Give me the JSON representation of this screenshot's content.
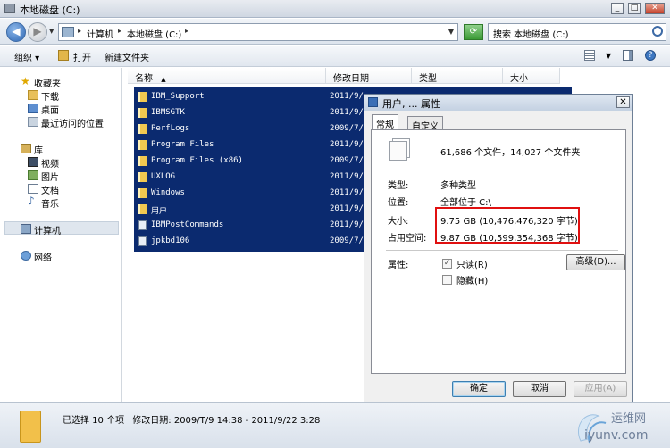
{
  "window": {
    "title": "本地磁盘 (C:)",
    "buttons": {
      "minimize": "_",
      "maximize": "□",
      "close": "✕"
    }
  },
  "address": {
    "crumbs": [
      "计算机",
      "本地磁盘 (C:)"
    ],
    "search_placeholder": "搜索 本地磁盘 (C:)"
  },
  "toolbar": {
    "organize": "组织 ▾",
    "open": "打开",
    "new_folder": "新建文件夹"
  },
  "nav": {
    "favorites": "收藏夹",
    "fav_items": [
      "下载",
      "桌面",
      "最近访问的位置"
    ],
    "libraries": "库",
    "lib_items": [
      "视频",
      "图片",
      "文档",
      "音乐"
    ],
    "computer": "计算机",
    "network": "网络"
  },
  "columns": [
    "名称",
    "修改日期",
    "类型",
    "大小"
  ],
  "files": [
    {
      "name": "IBM_Support",
      "date": "2011/9/"
    },
    {
      "name": "IBMSGTK",
      "date": "2011/9/"
    },
    {
      "name": "PerfLogs",
      "date": "2009/7/"
    },
    {
      "name": "Program Files",
      "date": "2011/9/"
    },
    {
      "name": "Program Files (x86)",
      "date": "2009/7/"
    },
    {
      "name": "UXLOG",
      "date": "2011/9/"
    },
    {
      "name": "Windows",
      "date": "2011/9/"
    },
    {
      "name": "用户",
      "date": "2011/9/"
    },
    {
      "name": "IBMPostCommands",
      "date": "2011/9/"
    },
    {
      "name": "jpkbd106",
      "date": "2009/7/"
    }
  ],
  "status": {
    "selected": "已选择 10 个项",
    "modified": "修改日期: 2009/T/9 14:38 - 2011/9/22 3:28"
  },
  "dialog": {
    "title": "用户, ... 属性",
    "close": "✕",
    "tabs": [
      "常规",
      "自定义"
    ],
    "summary": "61,686 个文件，14,027 个文件夹",
    "type_label": "类型:",
    "type_value": "多种类型",
    "location_label": "位置:",
    "location_value": "全部位于 C:\\",
    "size_label": "大小:",
    "size_value": "9.75 GB (10,476,476,320 字节)",
    "disk_label": "占用空间:",
    "disk_value": "9.87 GB (10,599,354,368 字节)",
    "attr_label": "属性:",
    "readonly": "只读(R)",
    "hidden": "隐藏(H)",
    "advanced": "高级(D)...",
    "ok": "确定",
    "cancel": "取消",
    "apply": "应用(A)"
  },
  "watermark": {
    "text": "运维网",
    "url": "iyunv.com"
  },
  "colors": {
    "selection": "#0b2a6f",
    "highlight_box": "#e01010"
  }
}
